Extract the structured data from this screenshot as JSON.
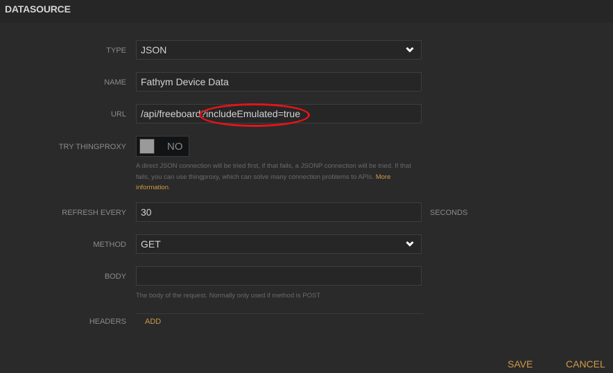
{
  "header": {
    "title": "DATASOURCE"
  },
  "form": {
    "type": {
      "label": "TYPE",
      "value": "JSON",
      "icon": "chevron-down-icon"
    },
    "name": {
      "label": "NAME",
      "value": "Fathym Device Data"
    },
    "url": {
      "label": "URL",
      "value": "/api/freeboard?includeEmulated=true"
    },
    "thingproxy": {
      "label": "TRY THINGPROXY",
      "state": "NO",
      "help_text": "A direct JSON connection will be tried first, if that fails, a JSONP connection will be tried. If that fails, you can use thingproxy, which can solve many connection problems to APIs.",
      "help_link": "More information",
      "help_link_suffix": "."
    },
    "refresh": {
      "label": "REFRESH EVERY",
      "value": "30",
      "suffix": "SECONDS"
    },
    "method": {
      "label": "METHOD",
      "value": "GET",
      "icon": "chevron-down-icon"
    },
    "body": {
      "label": "BODY",
      "value": "",
      "help_text": "The body of the request. Normally only used if method is POST"
    },
    "headers": {
      "label": "HEADERS",
      "add_label": "ADD"
    }
  },
  "footer": {
    "save_label": "SAVE",
    "cancel_label": "CANCEL"
  },
  "annotation": {
    "type": "red-ellipse",
    "highlights": "?includeEmulated=true",
    "color": "#e3141b"
  },
  "colors": {
    "accent": "#d19a4a",
    "background": "#2a2a2a",
    "header": "#262626"
  }
}
